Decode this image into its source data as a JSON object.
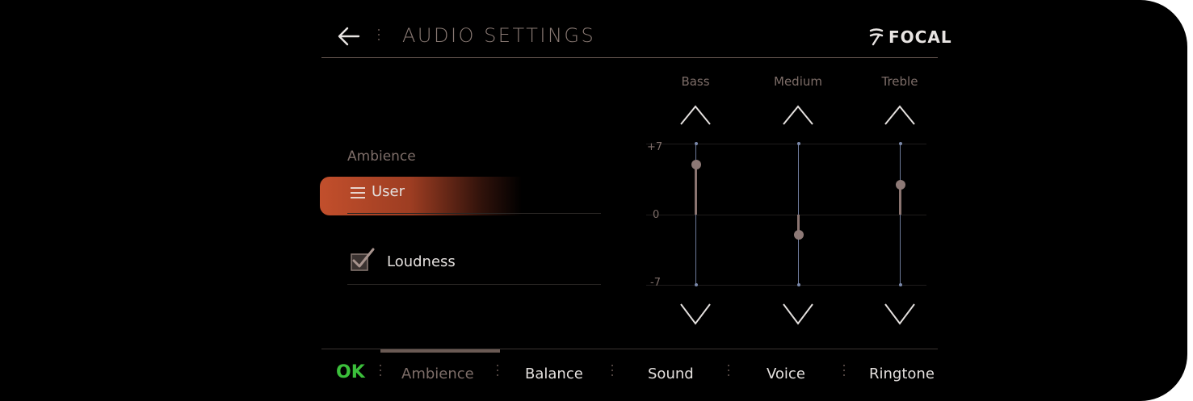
{
  "header": {
    "title": "AUDIO SETTINGS",
    "brand": "FOCAL",
    "back_icon": "arrow-left-icon"
  },
  "left_panel": {
    "ambience_label": "Ambience",
    "ambience_value": "User",
    "ambience_icon": "menu-icon",
    "loudness_label": "Loudness",
    "loudness_checked": true
  },
  "equalizer": {
    "axis_top": "+7",
    "axis_mid": "0",
    "axis_bottom": "-7",
    "bands": [
      {
        "label": "Bass",
        "value": 5
      },
      {
        "label": "Medium",
        "value": -2
      },
      {
        "label": "Treble",
        "value": 3
      }
    ]
  },
  "footer": {
    "ok_label": "OK",
    "tabs": [
      "Ambience",
      "Balance",
      "Sound",
      "Voice",
      "Ringtone"
    ],
    "active_tab": "Ambience"
  },
  "colors": {
    "accent": "#c24f2c",
    "ok_green": "#3bbf3b",
    "background": "#000000"
  }
}
